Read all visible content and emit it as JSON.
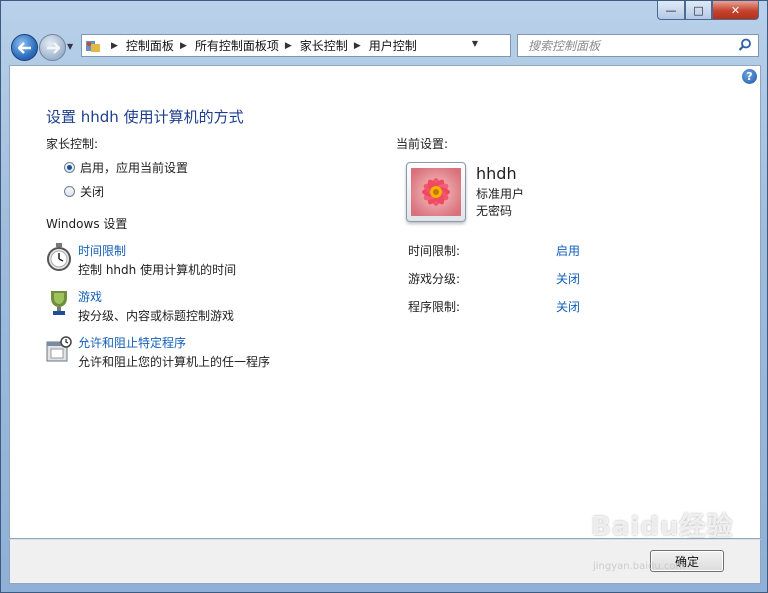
{
  "window": {
    "caption": {
      "minimize": "—",
      "maximize": "□",
      "close": "✕"
    }
  },
  "nav": {
    "breadcrumbs": [
      "控制面板",
      "所有控制面板项",
      "家长控制",
      "用户控制"
    ],
    "search_placeholder": "搜索控制面板"
  },
  "main": {
    "title": "设置 hhdh 使用计算机的方式",
    "parental_control_label": "家长控制:",
    "radio_on": "启用，应用当前设置",
    "radio_off": "关闭",
    "radio_selected": "on",
    "windows_settings_label": "Windows 设置",
    "items": [
      {
        "link": "时间限制",
        "desc": "控制 hhdh 使用计算机的时间",
        "icon": "stopwatch-icon"
      },
      {
        "link": "游戏",
        "desc": "按分级、内容或标题控制游戏",
        "icon": "game-trophy-icon"
      },
      {
        "link": "允许和阻止特定程序",
        "desc": "允许和阻止您的计算机上的任一程序",
        "icon": "program-block-icon"
      }
    ]
  },
  "current": {
    "label": "当前设置:",
    "username": "hhdh",
    "account_type": "标准用户",
    "password_status": "无密码",
    "settings": [
      {
        "label": "时间限制:",
        "value": "启用"
      },
      {
        "label": "游戏分级:",
        "value": "关闭"
      },
      {
        "label": "程序限制:",
        "value": "关闭"
      }
    ]
  },
  "footer": {
    "ok_label": "确定"
  },
  "watermark": {
    "text": "Baidu经验",
    "sub": "jingyan.baidu.com"
  },
  "colors": {
    "link": "#1360b8",
    "title": "#1e3f8f",
    "accent": "#2d6fbf"
  }
}
